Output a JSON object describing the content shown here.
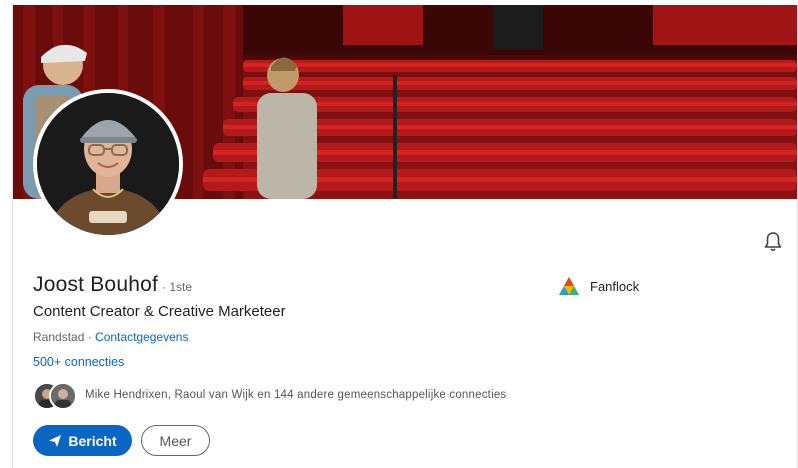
{
  "profile": {
    "name": "Joost Bouhof",
    "degree": "· 1ste",
    "headline": "Content Creator & Creative Marketeer",
    "location": "Randstad ·",
    "contact_link": "Contactgegevens",
    "connections": "500+ connecties",
    "mutual_connections": "Mike Hendrixen, Raoul van Wijk en 144 andere gemeenschappelijke connecties"
  },
  "company": {
    "name": "Fanflock"
  },
  "actions": {
    "message_label": "Bericht",
    "more_label": "Meer"
  },
  "icons": {
    "notification": "bell-icon",
    "message": "send-icon",
    "company_logo": "fanflock-logo"
  },
  "colors": {
    "accent": "#0a66c2",
    "banner": "#8f1212"
  }
}
